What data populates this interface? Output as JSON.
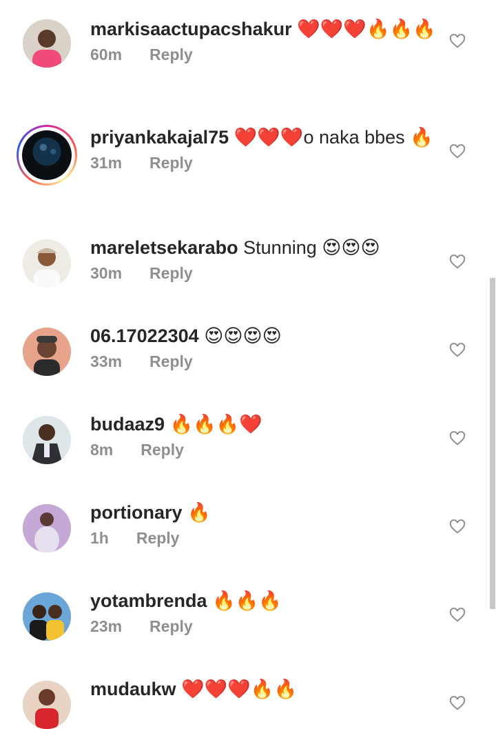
{
  "comments": [
    {
      "username": "markisaactupacshakur",
      "text": "❤️❤️❤️🔥🔥🔥",
      "time": "60m",
      "reply": "Reply"
    },
    {
      "username": "priyankakajal75",
      "text": "❤️❤️❤️o naka bbes 🔥",
      "time": "31m",
      "reply": "Reply"
    },
    {
      "username": "mareletsekarabo",
      "text": "Stunning 😍😍😍",
      "time": "30m",
      "reply": "Reply"
    },
    {
      "username": "06.17022304",
      "text": "😍😍😍😍",
      "time": "33m",
      "reply": "Reply"
    },
    {
      "username": "budaaz9",
      "text": "🔥🔥🔥❤️",
      "time": "8m",
      "reply": "Reply"
    },
    {
      "username": "portionary",
      "text": "🔥",
      "time": "1h",
      "reply": "Reply"
    },
    {
      "username": "yotambrenda",
      "text": "🔥🔥🔥",
      "time": "23m",
      "reply": "Reply"
    },
    {
      "username": "mudaukw",
      "text": "❤️❤️❤️🔥🔥",
      "time": "",
      "reply": ""
    }
  ],
  "icons": {
    "like": "heart-outline-icon"
  },
  "colors": {
    "username": "#262626",
    "meta": "#8e8e8e",
    "heart": "#8e8e8e"
  }
}
